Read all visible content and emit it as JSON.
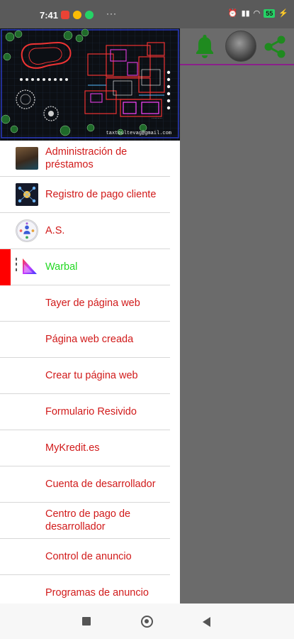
{
  "status_bar": {
    "time": "7:41",
    "more": "···",
    "battery": "55"
  },
  "header": {
    "email": "taxtoultevag@gmail.com"
  },
  "menu": {
    "items": [
      {
        "label": "Administración de préstamos",
        "icon": "person-photo-icon"
      },
      {
        "label": "Registro de pago cliente",
        "icon": "network-photo-icon"
      },
      {
        "label": "A.S.",
        "icon": "team-circle-icon"
      },
      {
        "label": "Warbal",
        "icon": "color-triangle-icon",
        "selected": true
      },
      {
        "label": "Tayer de página web"
      },
      {
        "label": "Página web creada"
      },
      {
        "label": "Crear tu página web"
      },
      {
        "label": "Formulario Resivido"
      },
      {
        "label": "MyKredit.es"
      },
      {
        "label": "Cuenta de desarrollador"
      },
      {
        "label": "Centro de pago de desarrollador"
      },
      {
        "label": "Control de anuncio"
      },
      {
        "label": "Programas de anuncio"
      }
    ]
  },
  "colors": {
    "menu_text": "#d11a1a",
    "selected_text": "#22d822",
    "selected_bar": "#ff0000",
    "toolbar_icons": "#1f8a1f",
    "toolbar_underline": "#8a1f8a"
  }
}
